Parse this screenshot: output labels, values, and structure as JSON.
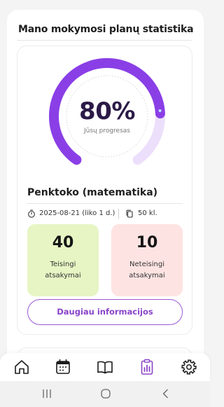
{
  "page": {
    "section_title": "Mano mokymosi planų statistika"
  },
  "progress": {
    "value_text": "80%",
    "value": 0.8,
    "caption": "Jūsų progresas",
    "arc_color": "#8a3fe6",
    "track_color": "#ecdffb"
  },
  "plan": {
    "name": "Penktoko (matematika)",
    "date": "2025-08-21 (liko 1 d.)",
    "class": "50 kl.",
    "correct": {
      "number": "40",
      "label": "Teisingi atsakymai",
      "color": "#e7f5c4"
    },
    "wrong": {
      "number": "10",
      "label": "Neteisingi atsakymai",
      "color": "#fde4e2"
    },
    "more_button": "Daugiau informacijos"
  },
  "bottom_nav": {
    "items": [
      "home-icon",
      "calendar-icon",
      "book-icon",
      "stats-icon",
      "settings-icon"
    ],
    "active": "stats-icon",
    "active_color": "#8a44c9"
  },
  "system_nav": {
    "items": [
      "recent-apps-icon",
      "home-circle-icon",
      "back-icon"
    ]
  }
}
